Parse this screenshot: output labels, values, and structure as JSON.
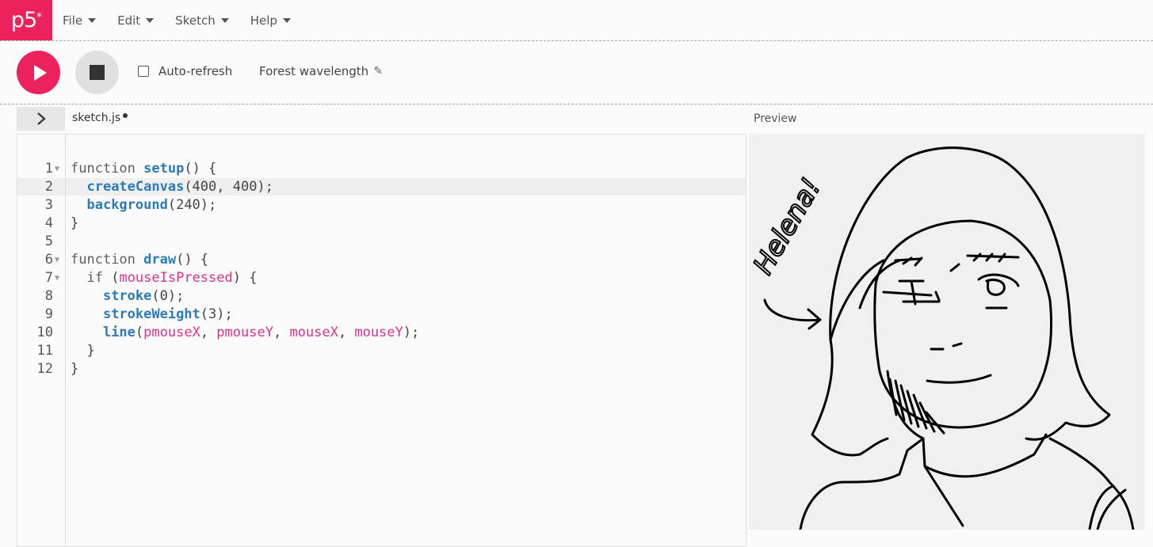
{
  "logo": {
    "text": "p5",
    "mark": "*"
  },
  "menu": [
    {
      "label": "File"
    },
    {
      "label": "Edit"
    },
    {
      "label": "Sketch"
    },
    {
      "label": "Help"
    }
  ],
  "toolbar": {
    "play_icon": "play-icon",
    "stop_icon": "stop-icon",
    "auto_refresh_label": "Auto-refresh",
    "auto_refresh_checked": false,
    "sketch_name": "Forest wavelength",
    "edit_icon": "pencil-icon"
  },
  "editor": {
    "sidebar_toggle_icon": "chevron-right-icon",
    "tab_name": "sketch.js",
    "unsaved": true,
    "line_numbers": [
      "1",
      "2",
      "3",
      "4",
      "5",
      "6",
      "7",
      "8",
      "9",
      "10",
      "11",
      "12"
    ],
    "active_line": 2,
    "foldable_lines": [
      1,
      6,
      7
    ],
    "lines": [
      "function setup() {",
      "  createCanvas(400, 400);",
      "  background(240);",
      "}",
      "",
      "function draw() {",
      "  if (mouseIsPressed) {",
      "    stroke(0);",
      "    strokeWeight(3);",
      "    line(pmouseX, pmouseY, mouseX, mouseY);",
      "  }",
      "}"
    ]
  },
  "preview": {
    "label": "Preview",
    "canvas_background": "#f0f0f0",
    "drawing_text": "Helena!"
  },
  "colors": {
    "accent": "#ed225d",
    "keyword_function": "#2d7bb6",
    "variable": "#d9328a"
  }
}
